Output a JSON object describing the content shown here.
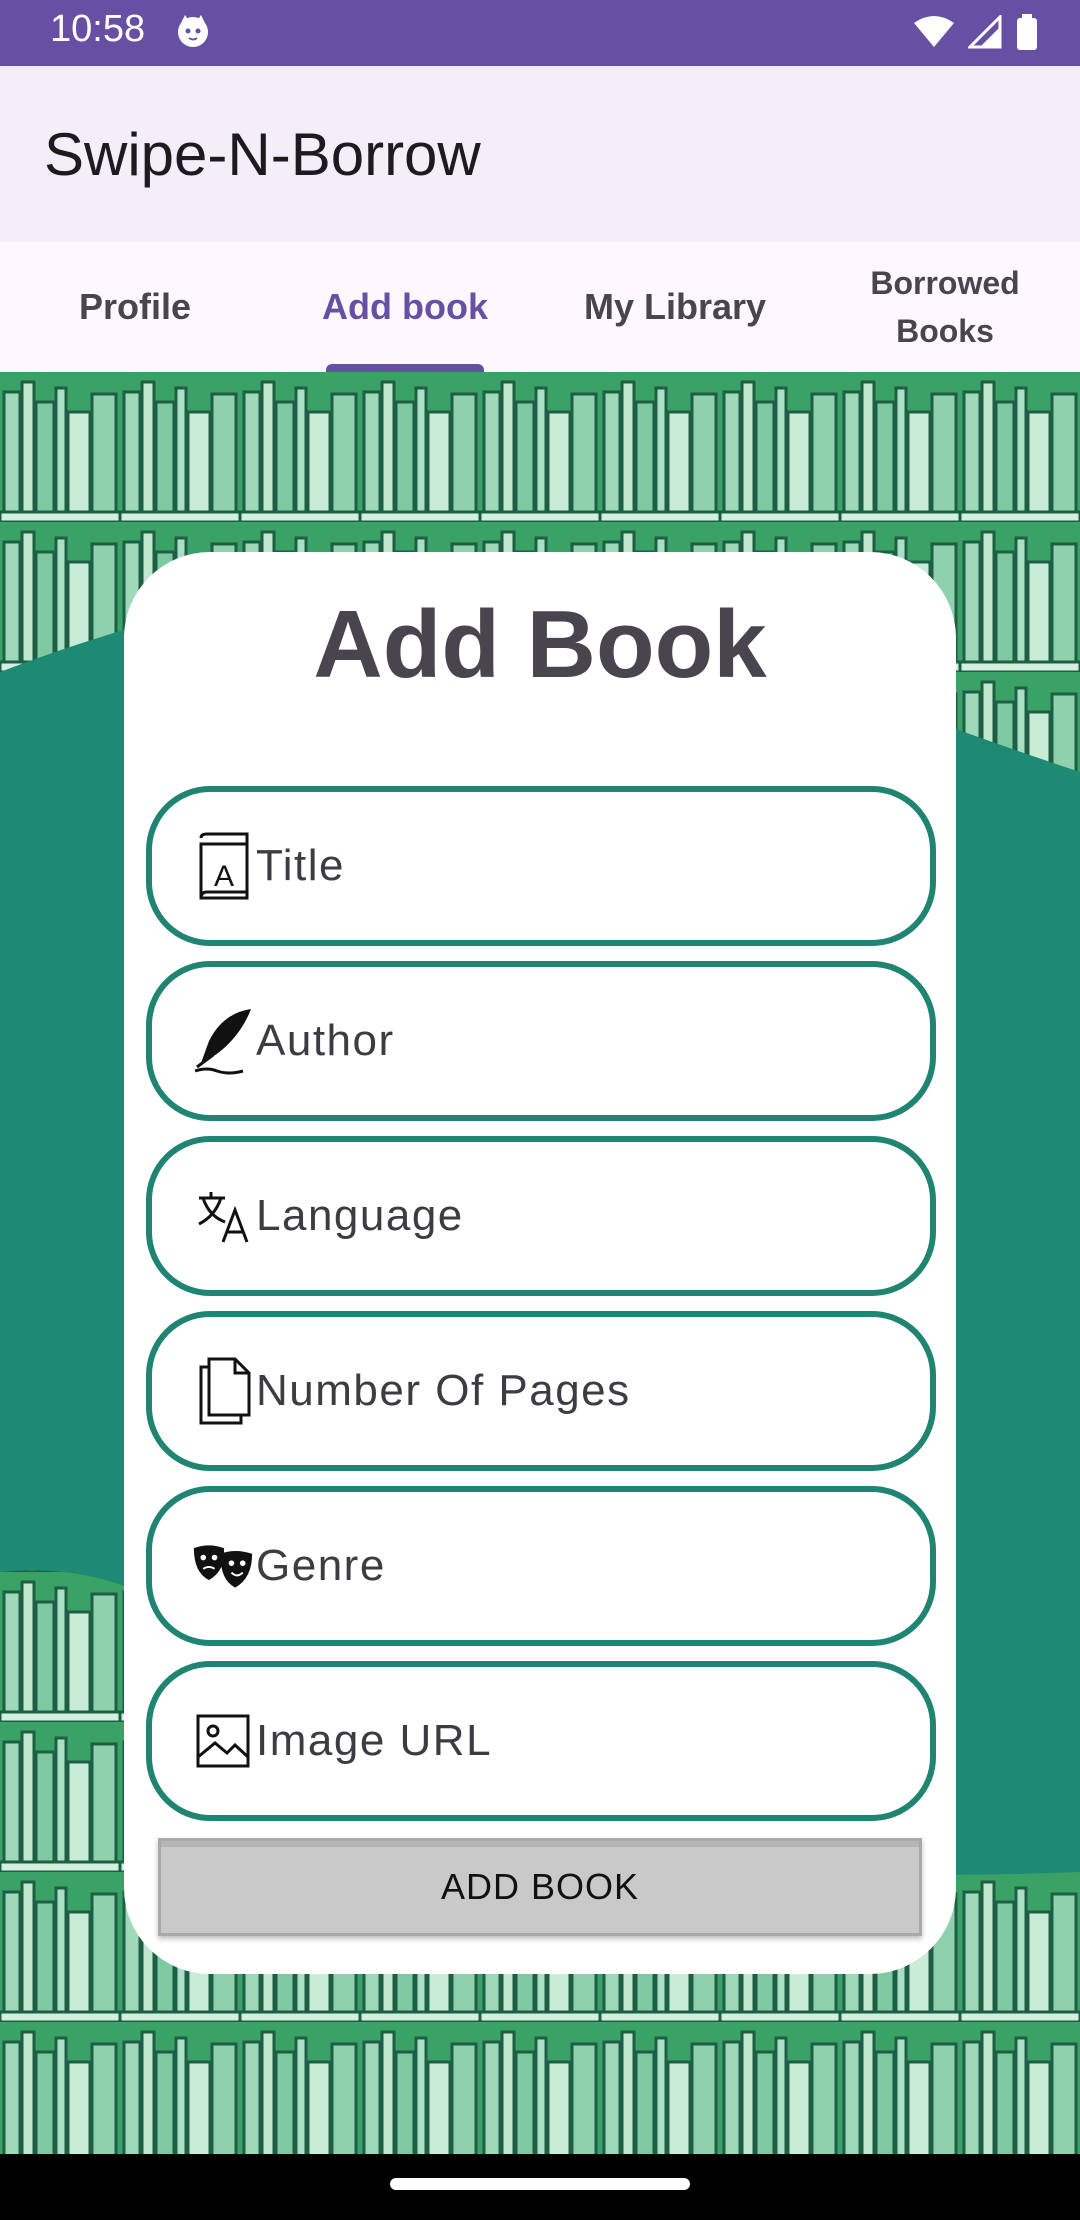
{
  "status_bar": {
    "time": "10:58",
    "icons": [
      "cat-notification-icon",
      "wifi-icon",
      "signal-icon",
      "battery-icon"
    ]
  },
  "app_bar": {
    "title": "Swipe-N-Borrow"
  },
  "tabs": [
    {
      "label": "Profile",
      "active": false
    },
    {
      "label": "Add book",
      "active": true
    },
    {
      "label": "My Library",
      "active": false
    },
    {
      "label": "Borrowed\nBooks",
      "line1": "Borrowed",
      "line2": "Books",
      "active": false
    }
  ],
  "form": {
    "title": "Add Book",
    "fields": [
      {
        "placeholder": "Title",
        "icon": "book-icon"
      },
      {
        "placeholder": "Author",
        "icon": "quill-pen-icon"
      },
      {
        "placeholder": "Language",
        "icon": "translate-icon"
      },
      {
        "placeholder": "Number Of Pages",
        "icon": "pages-icon"
      },
      {
        "placeholder": "Genre",
        "icon": "theater-masks-icon"
      },
      {
        "placeholder": "Image URL",
        "icon": "image-icon"
      }
    ],
    "submit_label": "ADD BOOK"
  },
  "colors": {
    "primary": "#6750a4",
    "accent_teal": "#1f8472",
    "background_green": "#1f8a74"
  }
}
